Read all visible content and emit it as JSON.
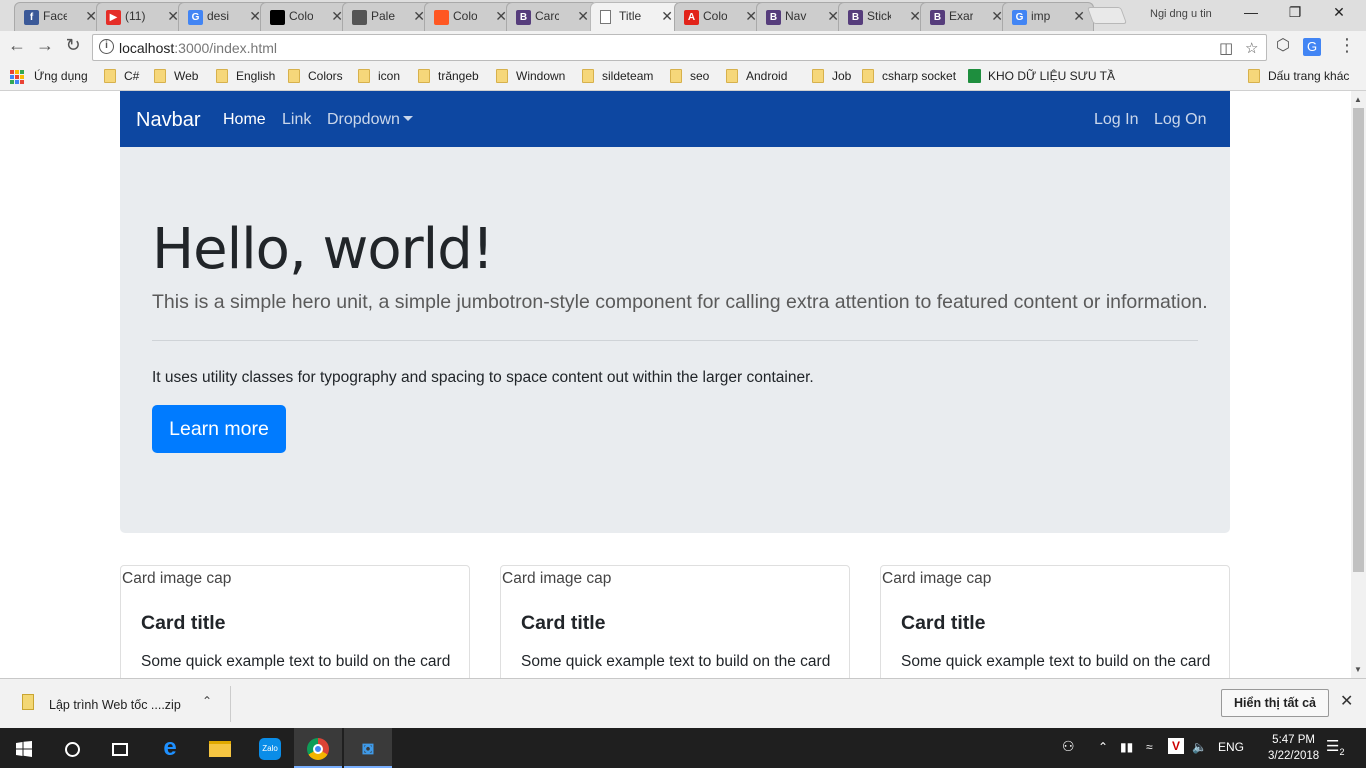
{
  "browser": {
    "tabs": [
      {
        "label": "Face",
        "icon": "facebook-icon",
        "color": "#3b5998",
        "glyph": "f"
      },
      {
        "label": "(11)",
        "icon": "youtube-icon",
        "color": "#e52d27",
        "glyph": "▶"
      },
      {
        "label": "desi",
        "icon": "google-icon",
        "color": "#4285f4",
        "glyph": "G"
      },
      {
        "label": "Colo",
        "icon": "flag-icon",
        "color": "#000000",
        "glyph": ""
      },
      {
        "label": "Pale",
        "icon": "palette-icon",
        "color": "#555555",
        "glyph": ""
      },
      {
        "label": "Colo",
        "icon": "color-wheel-icon",
        "color": "#ff5722",
        "glyph": ""
      },
      {
        "label": "Carc",
        "icon": "bootstrap-icon",
        "color": "#563d7c",
        "glyph": "B"
      },
      {
        "label": "Title",
        "icon": "page-icon",
        "color": "#ffffff",
        "glyph": "",
        "active": true
      },
      {
        "label": "Colo",
        "icon": "adobe-icon",
        "color": "#e2231a",
        "glyph": "A"
      },
      {
        "label": "Nav",
        "icon": "bootstrap-icon",
        "color": "#563d7c",
        "glyph": "B"
      },
      {
        "label": "Stick",
        "icon": "bootstrap-icon",
        "color": "#563d7c",
        "glyph": "B"
      },
      {
        "label": "Exar",
        "icon": "bootstrap-icon",
        "color": "#563d7c",
        "glyph": "B"
      },
      {
        "label": "imp",
        "icon": "google-icon",
        "color": "#4285f4",
        "glyph": "G"
      }
    ],
    "profile_name": "Ngi dng u tin",
    "url_host": "localhost",
    "url_rest": ":3000/index.html",
    "bookmarks": [
      {
        "label": "Ứng dụng",
        "icon": "apps-grid-icon"
      },
      {
        "label": "C#",
        "icon": "folder-icon"
      },
      {
        "label": "Web",
        "icon": "folder-icon"
      },
      {
        "label": "English",
        "icon": "folder-icon"
      },
      {
        "label": "Colors",
        "icon": "folder-icon"
      },
      {
        "label": "icon",
        "icon": "folder-icon"
      },
      {
        "label": "trăngeb",
        "icon": "folder-icon"
      },
      {
        "label": "Windown",
        "icon": "folder-icon"
      },
      {
        "label": "sildeteam",
        "icon": "folder-icon"
      },
      {
        "label": "seo",
        "icon": "folder-icon"
      },
      {
        "label": "Android",
        "icon": "folder-icon"
      },
      {
        "label": "Job",
        "icon": "folder-icon"
      },
      {
        "label": "csharp socket",
        "icon": "folder-icon"
      },
      {
        "label": "KHO DỮ LIỆU SƯU TẦ",
        "icon": "sheets-icon"
      }
    ],
    "other_bookmarks": "Dấu trang khác"
  },
  "page": {
    "navbar": {
      "brand": "Navbar",
      "links": [
        "Home",
        "Link",
        "Dropdown"
      ],
      "right_links": [
        "Log In",
        "Log On"
      ],
      "color": "#0d47a1"
    },
    "jumbotron": {
      "heading": "Hello, world!",
      "lead": "This is a simple hero unit, a simple jumbotron-style component for calling extra attention to featured content or information.",
      "text": "It uses utility classes for typography and spacing to space content out within the larger container.",
      "button": "Learn more"
    },
    "cards": [
      {
        "img_alt": "Card image cap",
        "title": "Card title",
        "text": "Some quick example text to build on the card title and make up the bulk of the"
      },
      {
        "img_alt": "Card image cap",
        "title": "Card title",
        "text": "Some quick example text to build on the card title and make up the bulk of the"
      },
      {
        "img_alt": "Card image cap",
        "title": "Card title",
        "text": "Some quick example text to build on the card title and make up the bulk of the"
      }
    ]
  },
  "downloads": {
    "file": "Lập trình Web tốc ....zip",
    "show_all": "Hiển thị tất cả"
  },
  "taskbar": {
    "lang": "ENG",
    "time": "5:47 PM",
    "date": "3/22/2018",
    "notifications": "2"
  }
}
